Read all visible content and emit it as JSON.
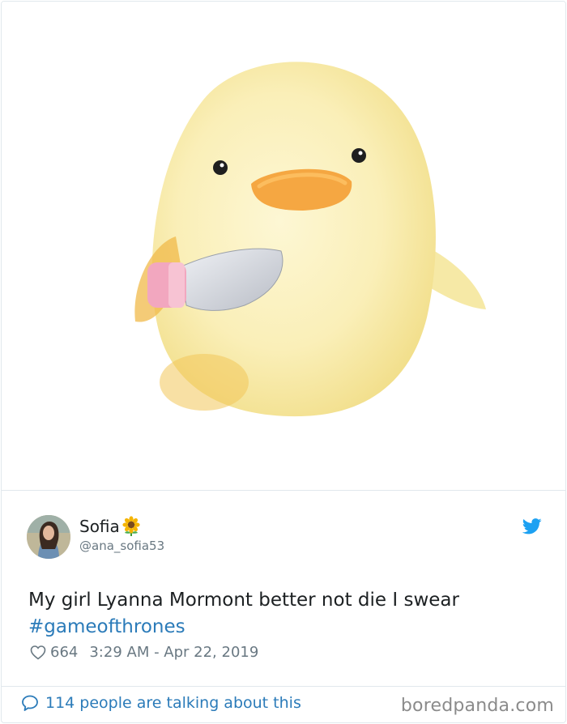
{
  "tweet": {
    "author_name": "Sofia",
    "author_emoji": "sunflower-icon",
    "handle": "@ana_sofia53",
    "text": "My girl Lyanna Mormont better not die I swear",
    "hashtag": "#gameofthrones",
    "likes": "664",
    "timestamp": "3:29 AM - Apr 22, 2019",
    "conversation": "114 people are talking about this"
  },
  "media": {
    "subject": "plush chick holding knife"
  },
  "watermark": "boredpanda.com",
  "colors": {
    "link": "#2b7bb9",
    "twitter_blue": "#1da1f2",
    "muted": "#697882",
    "border": "#e1e8ed"
  }
}
